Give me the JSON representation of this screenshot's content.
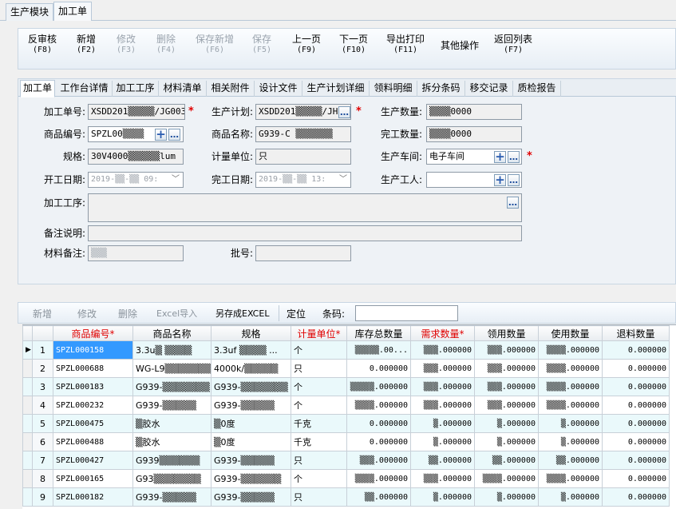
{
  "module_tabs": [
    "生产模块",
    "加工单"
  ],
  "toolbar": [
    {
      "label": "反审核",
      "key": "(F8)",
      "enabled": true
    },
    {
      "label": "新增",
      "key": "(F2)",
      "enabled": true
    },
    {
      "label": "修改",
      "key": "(F3)",
      "enabled": false
    },
    {
      "label": "删除",
      "key": "(F4)",
      "enabled": false
    },
    {
      "label": "保存新增",
      "key": "(F6)",
      "enabled": false
    },
    {
      "label": "保存",
      "key": "(F5)",
      "enabled": false
    },
    {
      "label": "上一页",
      "key": "(F9)",
      "enabled": true
    },
    {
      "label": "下一页",
      "key": "(F10)",
      "enabled": true
    },
    {
      "label": "导出打印",
      "key": "(F11)",
      "enabled": true
    },
    {
      "label": "其他操作",
      "key": "",
      "enabled": true
    },
    {
      "label": "返回列表",
      "key": "(F7)",
      "enabled": true
    }
  ],
  "form_tabs": [
    "加工单",
    "工作台详情",
    "加工工序",
    "材料清单",
    "相关附件",
    "设计文件",
    "生产计划详细",
    "领料明细",
    "拆分条码",
    "移交记录",
    "质检报告"
  ],
  "form": {
    "order_no_label": "加工单号:",
    "order_no": "XSDD201▒▒▒▒▒/JG003",
    "plan_label": "生产计划:",
    "plan": "XSDD201▒▒▒▒▒/JHC",
    "qty_label": "生产数量:",
    "qty": "▒▒▒▒0000",
    "product_code_label": "商品编号:",
    "product_code": "SPZL00▒▒▒▒",
    "product_name_label": "商品名称:",
    "product_name": "G939-C  ▒▒▒▒▒▒▒",
    "done_qty_label": "完工数量:",
    "done_qty": "▒▒▒▒0000",
    "spec_label": "规格:",
    "spec": "30V4000▒▒▒▒▒▒lum",
    "unit_label": "计量单位:",
    "unit": "只",
    "workshop_label": "生产车间:",
    "workshop": "电子车间",
    "start_label": "开工日期:",
    "start": "2019-▒▒-▒▒ 09:",
    "end_label": "完工日期:",
    "end": "2019-▒▒-▒▒ 13:",
    "worker_label": "生产工人:",
    "worker": "",
    "process_label": "加工工序:",
    "remark_label": "备注说明:",
    "material_remark_label": "材料备注:",
    "material_remark": "▒▒▒",
    "batch_label": "批号:"
  },
  "grid_toolbar": {
    "add": "新增",
    "edit": "修改",
    "delete": "删除",
    "excel_import": "Excel导入",
    "save_excel": "另存成EXCEL",
    "locate": "定位",
    "barcode_label": "条码:"
  },
  "columns": [
    {
      "label": "商品编号*",
      "required": true
    },
    {
      "label": "商品名称",
      "required": false
    },
    {
      "label": "规格",
      "required": false
    },
    {
      "label": "计量单位*",
      "required": true
    },
    {
      "label": "库存总数量",
      "required": false
    },
    {
      "label": "需求数量*",
      "required": true
    },
    {
      "label": "领用数量",
      "required": false
    },
    {
      "label": "使用数量",
      "required": false
    },
    {
      "label": "退料数量",
      "required": false
    }
  ],
  "rows": [
    {
      "n": "1",
      "code": "SPZL000158",
      "name": "3.3u▒ ▒▒▒▒",
      "spec": "3.3uf ▒▒▒▒  ...",
      "unit": "个",
      "stock": "▒▒▒▒▒.00...",
      "need": "▒▒▒.000000",
      "take": "▒▒▒.000000",
      "use": "▒▒▒▒.000000",
      "ret": "0.000000"
    },
    {
      "n": "2",
      "code": "SPZL000688",
      "name": "WG-L9▒▒▒▒▒▒▒▒",
      "spec": "4000k/▒▒▒▒▒",
      "unit": "只",
      "stock": "0.000000",
      "need": "▒▒▒.000000",
      "take": "▒▒▒.000000",
      "use": "▒▒▒▒.000000",
      "ret": "0.000000"
    },
    {
      "n": "3",
      "code": "SPZL000183",
      "name": "G939-▒▒▒▒▒▒▒",
      "spec": "G939-▒▒▒▒▒▒▒",
      "unit": "个",
      "stock": "▒▒▒▒▒.000000",
      "need": "▒▒▒.000000",
      "take": "▒▒▒.000000",
      "use": "▒▒▒▒.000000",
      "ret": "0.000000"
    },
    {
      "n": "4",
      "code": "SPZL000232",
      "name": "G939-▒▒▒▒▒",
      "spec": "G939-▒▒▒▒▒",
      "unit": "个",
      "stock": "▒▒▒▒.000000",
      "need": "▒▒▒.000000",
      "take": "▒▒▒.000000",
      "use": "▒▒▒▒.000000",
      "ret": "0.000000"
    },
    {
      "n": "5",
      "code": "SPZL000475",
      "name": "▒胶水",
      "spec": "▒0度",
      "unit": "千克",
      "stock": "0.000000",
      "need": "▒.000000",
      "take": "▒.000000",
      "use": "▒.000000",
      "ret": "0.000000"
    },
    {
      "n": "6",
      "code": "SPZL000488",
      "name": "▒胶水",
      "spec": "▒0度",
      "unit": "千克",
      "stock": "0.000000",
      "need": "▒.000000",
      "take": "▒.000000",
      "use": "▒.000000",
      "ret": "0.000000"
    },
    {
      "n": "7",
      "code": "SPZL000427",
      "name": "G939▒▒▒▒▒▒",
      "spec": "G939-▒▒▒▒▒",
      "unit": "只",
      "stock": "▒▒▒.000000",
      "need": "▒▒.000000",
      "take": "▒▒.000000",
      "use": "▒▒.000000",
      "ret": "0.000000"
    },
    {
      "n": "8",
      "code": "SPZL000165",
      "name": "G93▒▒▒▒▒▒▒",
      "spec": "G939-▒▒▒▒▒▒",
      "unit": "个",
      "stock": "▒▒▒▒.000000",
      "need": "▒▒▒.000000",
      "take": "▒▒▒▒.000000",
      "use": "▒▒▒▒.000000",
      "ret": "0.000000"
    },
    {
      "n": "9",
      "code": "SPZL000182",
      "name": "G939-▒▒▒▒▒",
      "spec": "G939-▒▒▒▒▒",
      "unit": "只",
      "stock": "▒▒.000000",
      "need": "▒.000000",
      "take": "▒.000000",
      "use": "▒.000000",
      "ret": "0.000000"
    }
  ]
}
